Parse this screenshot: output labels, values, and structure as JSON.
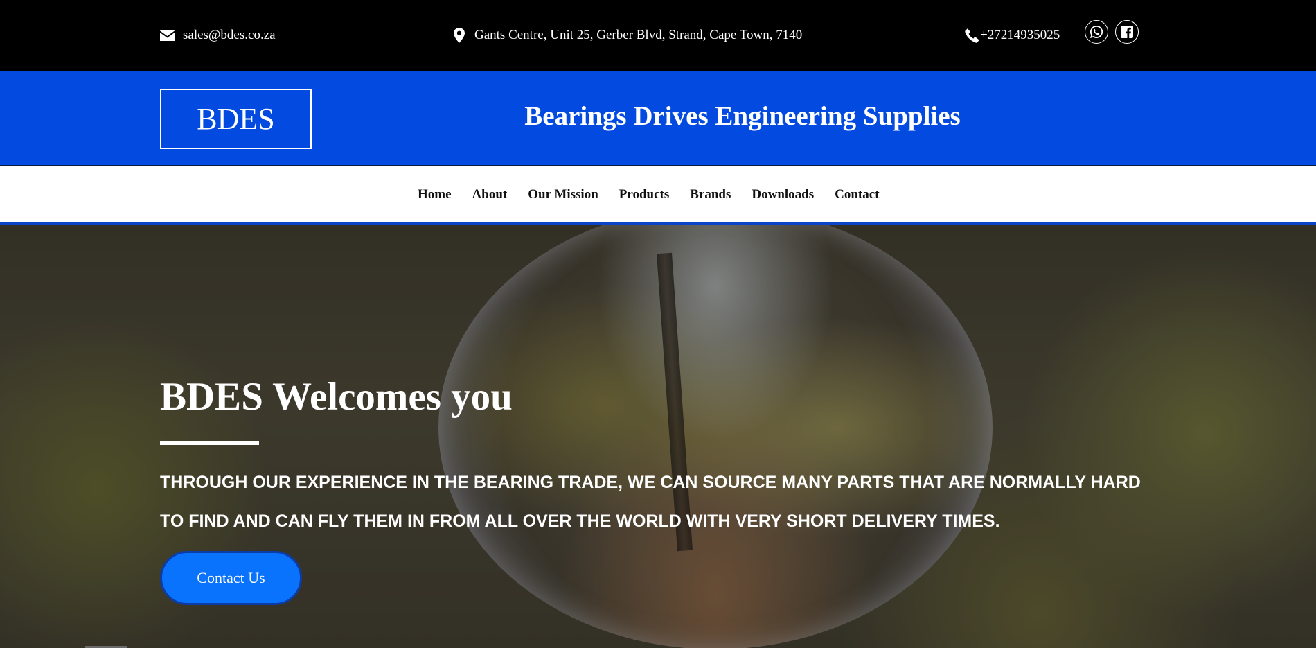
{
  "topbar": {
    "email": "sales@bdes.co.za",
    "address": "Gants Centre, Unit 25, Gerber Blvd, Strand, Cape Town, 7140",
    "phone": "+27214935025",
    "icons": {
      "email": "envelope-icon",
      "address": "map-pin-icon",
      "phone": "phone-icon",
      "whatsapp": "whatsapp-icon",
      "facebook": "facebook-icon"
    },
    "background": "#000000"
  },
  "brand": {
    "logo_text": "BDES",
    "title": "Bearings Drives Engineering Supplies",
    "background": "#034be0"
  },
  "nav": {
    "items": [
      {
        "label": "Home"
      },
      {
        "label": "About"
      },
      {
        "label": "Our Mission"
      },
      {
        "label": "Products"
      },
      {
        "label": "Brands"
      },
      {
        "label": "Downloads"
      },
      {
        "label": "Contact"
      }
    ],
    "accent": "#0a45c9"
  },
  "hero": {
    "title": "BDES Welcomes you",
    "text": "THROUGH OUR EXPERIENCE IN THE BEARING TRADE, WE CAN SOURCE MANY PARTS THAT ARE NORMALLY HARD TO FIND AND CAN FLY THEM IN FROM ALL OVER THE WORLD WITH VERY SHORT DELIVERY TIMES.",
    "button_label": "Contact Us",
    "button_color": "#0a73fe"
  }
}
